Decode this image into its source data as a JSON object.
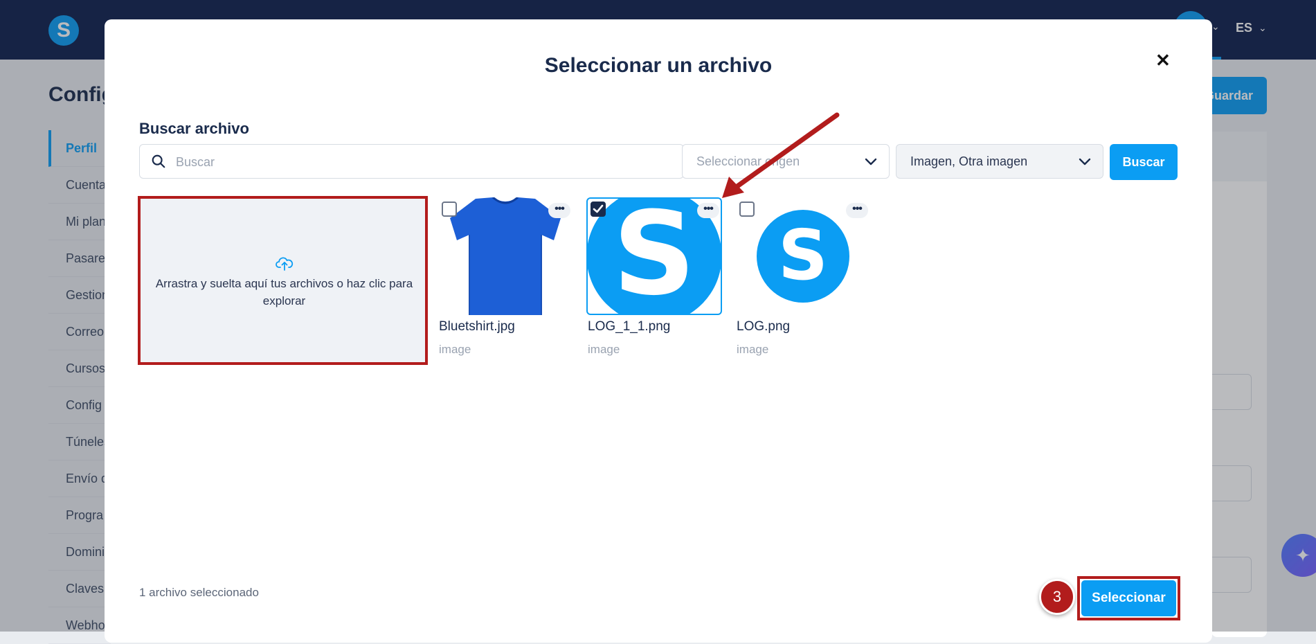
{
  "app": {
    "logo_letter": "S",
    "language": "ES",
    "page_title": "Config",
    "save_label": "Guardar",
    "sidebar": [
      "Perfil",
      "Cuenta",
      "Mi plan",
      "Pasarela",
      "Gestion",
      "Correo",
      "Cursos",
      "Config",
      "Túneles",
      "Envío d",
      "Progra",
      "Domini",
      "Claves",
      "Webho"
    ]
  },
  "modal": {
    "title": "Seleccionar un archivo",
    "close_symbol": "✕",
    "search_label": "Buscar archivo",
    "search_placeholder": "Buscar",
    "select_origin_placeholder": "Seleccionar origen",
    "select_type_value": "Imagen, Otra imagen",
    "search_button": "Buscar",
    "dropzone_text": "Arrastra y suelta aquí tus archivos o haz clic para explorar",
    "files": [
      {
        "name": "Bluetshirt.jpg",
        "type": "image",
        "selected": false
      },
      {
        "name": "LOG_1_1.png",
        "type": "image",
        "selected": true
      },
      {
        "name": "LOG.png",
        "type": "image",
        "selected": false
      }
    ],
    "selected_count_text": "1 archivo seleccionado",
    "step_number": "3",
    "select_button": "Seleccionar"
  },
  "colors": {
    "brand": "#0b9df3",
    "navy": "#0e1f4d",
    "highlight": "#b21c1c"
  }
}
